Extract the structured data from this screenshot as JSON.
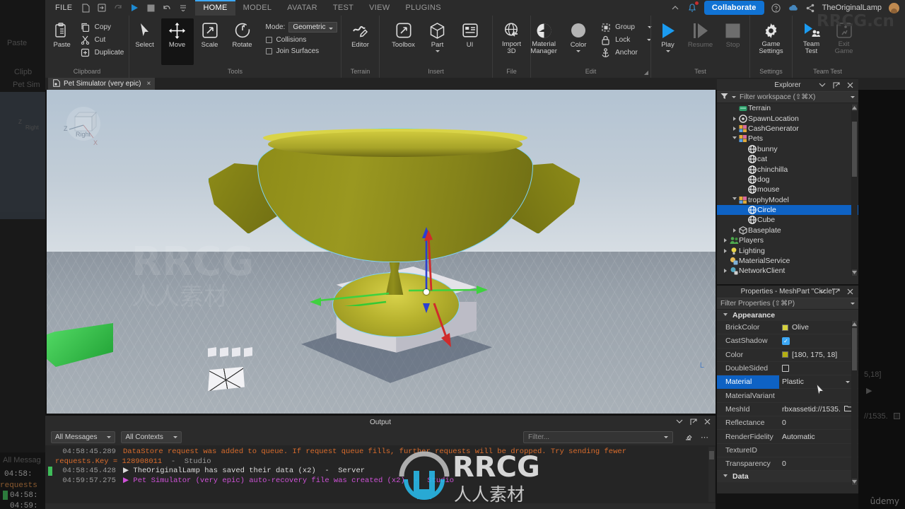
{
  "topbar": {
    "file_menu": "FILE",
    "quick_icons": [
      "new-file-icon",
      "open-file-icon",
      "redo-icon",
      "play-icon",
      "stop-icon",
      "undo-icon",
      "customize-icon"
    ],
    "tabs": [
      "HOME",
      "MODEL",
      "AVATAR",
      "TEST",
      "VIEW",
      "PLUGINS"
    ],
    "active_tab": "HOME",
    "collaborate_label": "Collaborate",
    "username": "TheOriginalLamp",
    "right_icons": [
      "chevron-up-icon",
      "notification-bell-icon",
      "help-icon",
      "cloud-icon",
      "share-icon"
    ]
  },
  "ribbon": {
    "groups": [
      {
        "label": "Clipboard",
        "big": [
          {
            "label": "Paste",
            "icon": "paste-icon",
            "selected": false
          }
        ],
        "small": [
          {
            "label": "Copy",
            "icon": "copy-icon"
          },
          {
            "label": "Cut",
            "icon": "cut-icon"
          },
          {
            "label": "Duplicate",
            "icon": "duplicate-icon"
          }
        ]
      },
      {
        "label": "Tools",
        "big": [
          {
            "label": "Select",
            "icon": "select-arrow-icon",
            "selected": false
          },
          {
            "label": "Move",
            "icon": "move-icon",
            "selected": true
          },
          {
            "label": "Scale",
            "icon": "scale-icon",
            "selected": false
          },
          {
            "label": "Rotate",
            "icon": "rotate-icon",
            "selected": false
          }
        ],
        "mode_label": "Mode:",
        "mode_value": "Geometric",
        "checks": [
          {
            "label": "Collisions",
            "checked": false
          },
          {
            "label": "Join Surfaces",
            "checked": false
          }
        ]
      },
      {
        "label": "Terrain",
        "big": [
          {
            "label": "Editor",
            "icon": "terrain-editor-icon",
            "selected": false
          }
        ]
      },
      {
        "label": "Insert",
        "big": [
          {
            "label": "Toolbox",
            "icon": "toolbox-icon",
            "selected": false
          },
          {
            "label": "Part",
            "icon": "part-cube-icon",
            "selected": false,
            "dropdown": true
          },
          {
            "label": "UI",
            "icon": "ui-icon",
            "selected": false
          }
        ]
      },
      {
        "label": "File",
        "big": [
          {
            "label": "Import\n3D",
            "icon": "import-3d-icon",
            "selected": false
          }
        ]
      },
      {
        "label": "Edit",
        "big": [
          {
            "label": "Material\nManager",
            "icon": "material-manager-icon",
            "selected": false
          },
          {
            "label": "Color",
            "icon": "color-circle-icon",
            "selected": false,
            "dropdown": true
          }
        ],
        "small": [
          {
            "label": "Group",
            "icon": "group-icon",
            "dropdown": true
          },
          {
            "label": "Lock",
            "icon": "lock-icon",
            "dropdown": true
          },
          {
            "label": "Anchor",
            "icon": "anchor-icon"
          }
        ]
      },
      {
        "label": "Test",
        "big": [
          {
            "label": "Play",
            "icon": "play-icon",
            "selected": false,
            "dropdown": true
          },
          {
            "label": "Resume",
            "icon": "resume-icon",
            "selected": false,
            "disabled": true
          },
          {
            "label": "Stop",
            "icon": "stop-icon",
            "selected": false,
            "disabled": true
          }
        ]
      },
      {
        "label": "Settings",
        "big": [
          {
            "label": "Game\nSettings",
            "icon": "gear-icon",
            "selected": false
          }
        ]
      },
      {
        "label": "Team Test",
        "big": [
          {
            "label": "Team\nTest",
            "icon": "team-test-icon",
            "selected": false
          },
          {
            "label": "Exit\nGame",
            "icon": "exit-game-icon",
            "selected": false,
            "disabled": true
          }
        ]
      }
    ]
  },
  "document_tab": {
    "title": "Pet Simulator (very epic)",
    "close_label": "×",
    "icon": "place-file-icon"
  },
  "viewport": {
    "viewcube": {
      "labels": [
        "Z",
        "Right",
        "X"
      ]
    },
    "corner_label": "L",
    "gizmo": "move-gizmo",
    "selected_object": "Circle"
  },
  "explorer": {
    "title": "Explorer",
    "filter_placeholder": "Filter workspace (⇧⌘X)",
    "controls": [
      "chevron-down-icon",
      "popout-icon",
      "close-icon"
    ],
    "items": [
      {
        "label": "Terrain",
        "depth": 1,
        "icon": "terrain-icon",
        "arrow": "none",
        "selected": false
      },
      {
        "label": "SpawnLocation",
        "depth": 1,
        "icon": "spawn-icon",
        "arrow": "right",
        "selected": false
      },
      {
        "label": "CashGenerator",
        "depth": 1,
        "icon": "model-icon",
        "arrow": "right",
        "selected": false
      },
      {
        "label": "Pets",
        "depth": 1,
        "icon": "model-icon",
        "arrow": "down",
        "selected": false
      },
      {
        "label": "bunny",
        "depth": 2,
        "icon": "meshpart-icon",
        "arrow": "none",
        "selected": false
      },
      {
        "label": "cat",
        "depth": 2,
        "icon": "meshpart-icon",
        "arrow": "none",
        "selected": false
      },
      {
        "label": "chinchilla",
        "depth": 2,
        "icon": "meshpart-icon",
        "arrow": "none",
        "selected": false
      },
      {
        "label": "dog",
        "depth": 2,
        "icon": "meshpart-icon",
        "arrow": "none",
        "selected": false
      },
      {
        "label": "mouse",
        "depth": 2,
        "icon": "meshpart-icon",
        "arrow": "none",
        "selected": false
      },
      {
        "label": "trophyModel",
        "depth": 1,
        "icon": "model-icon",
        "arrow": "down",
        "selected": false
      },
      {
        "label": "Circle",
        "depth": 2,
        "icon": "meshpart-icon",
        "arrow": "none",
        "selected": true
      },
      {
        "label": "Cube",
        "depth": 2,
        "icon": "meshpart-icon",
        "arrow": "none",
        "selected": false
      },
      {
        "label": "Baseplate",
        "depth": 1,
        "icon": "part-icon",
        "arrow": "right",
        "selected": false
      },
      {
        "label": "Players",
        "depth": 0,
        "icon": "players-icon",
        "arrow": "right",
        "selected": false
      },
      {
        "label": "Lighting",
        "depth": 0,
        "icon": "lighting-icon",
        "arrow": "right",
        "selected": false
      },
      {
        "label": "MaterialService",
        "depth": 0,
        "icon": "material-icon",
        "arrow": "none",
        "selected": false
      },
      {
        "label": "NetworkClient",
        "depth": 0,
        "icon": "network-icon",
        "arrow": "right",
        "selected": false
      }
    ]
  },
  "properties": {
    "title": "Properties - MeshPart \"Circle\"",
    "filter_placeholder": "Filter Properties (⇧⌘P)",
    "controls": [
      "chevron-down-icon",
      "popout-icon",
      "close-icon"
    ],
    "categories": [
      {
        "name": "Appearance",
        "expanded": true,
        "rows": [
          {
            "name": "BrickColor",
            "value": "Olive",
            "kind": "swatch",
            "swatch": "#d5d13c",
            "selected": false
          },
          {
            "name": "CastShadow",
            "value": "",
            "kind": "check-on",
            "selected": false
          },
          {
            "name": "Color",
            "value": "[180, 175, 18]",
            "kind": "swatch",
            "swatch": "#b4af12",
            "selected": false
          },
          {
            "name": "DoubleSided",
            "value": "",
            "kind": "check-off",
            "selected": false
          },
          {
            "name": "Material",
            "value": "Plastic",
            "kind": "dropdown",
            "selected": true
          },
          {
            "name": "MaterialVariant",
            "value": "",
            "kind": "text",
            "selected": false
          },
          {
            "name": "MeshId",
            "value": "rbxassetid://1535.",
            "kind": "file",
            "selected": false
          },
          {
            "name": "Reflectance",
            "value": "0",
            "kind": "text",
            "selected": false
          },
          {
            "name": "RenderFidelity",
            "value": "Automatic",
            "kind": "text",
            "selected": false
          },
          {
            "name": "TextureID",
            "value": "",
            "kind": "text",
            "selected": false
          },
          {
            "name": "Transparency",
            "value": "0",
            "kind": "text",
            "selected": false
          }
        ]
      },
      {
        "name": "Data",
        "expanded": true,
        "rows": []
      }
    ]
  },
  "output": {
    "title": "Output",
    "controls": [
      "chevron-down-icon",
      "popout-icon",
      "close-icon"
    ],
    "messages_filter": "All Messages",
    "contexts_filter": "All Contexts",
    "search_placeholder": "Filter...",
    "toolbar_icons": [
      "clear-output-icon",
      "more-options-icon"
    ],
    "lines": [
      {
        "timestamp": "04:58:45.289",
        "text": "DataStore request was added to queue. If request queue fills, further requests will be dropped. Try sending fewer",
        "color": "orange",
        "marker": "none",
        "expander": false
      },
      {
        "timestamp": "",
        "continuation": "requests.Key = 128908011",
        "suffix": "  -  Studio",
        "color": "orange",
        "marker": "none",
        "expander": false
      },
      {
        "timestamp": "04:58:45.428",
        "text": "TheOriginalLamp has saved their data (x2)  -  Server",
        "color": "white",
        "marker": "green",
        "expander": true
      },
      {
        "timestamp": "04:59:57.275",
        "text": "Pet Simulator (very epic) auto-recovery file was created (x2)  -  Studio",
        "color": "purple",
        "marker": "none",
        "expander": true
      }
    ]
  },
  "watermarks": {
    "top_right": "RRCG.cn",
    "center": "RRCG",
    "center_sub": "人人素材",
    "bottom_right": "ûdemy"
  },
  "colors": {
    "accent_blue": "#1173d4",
    "selection_blue": "#0e62c4",
    "ribbon_bg": "#2b2b2b",
    "panel_bg": "#2b2b2b",
    "log_bg": "#252525",
    "orange": "#d96c2c",
    "purple": "#cf52d8",
    "trophy_olive": "#8e8c18"
  }
}
